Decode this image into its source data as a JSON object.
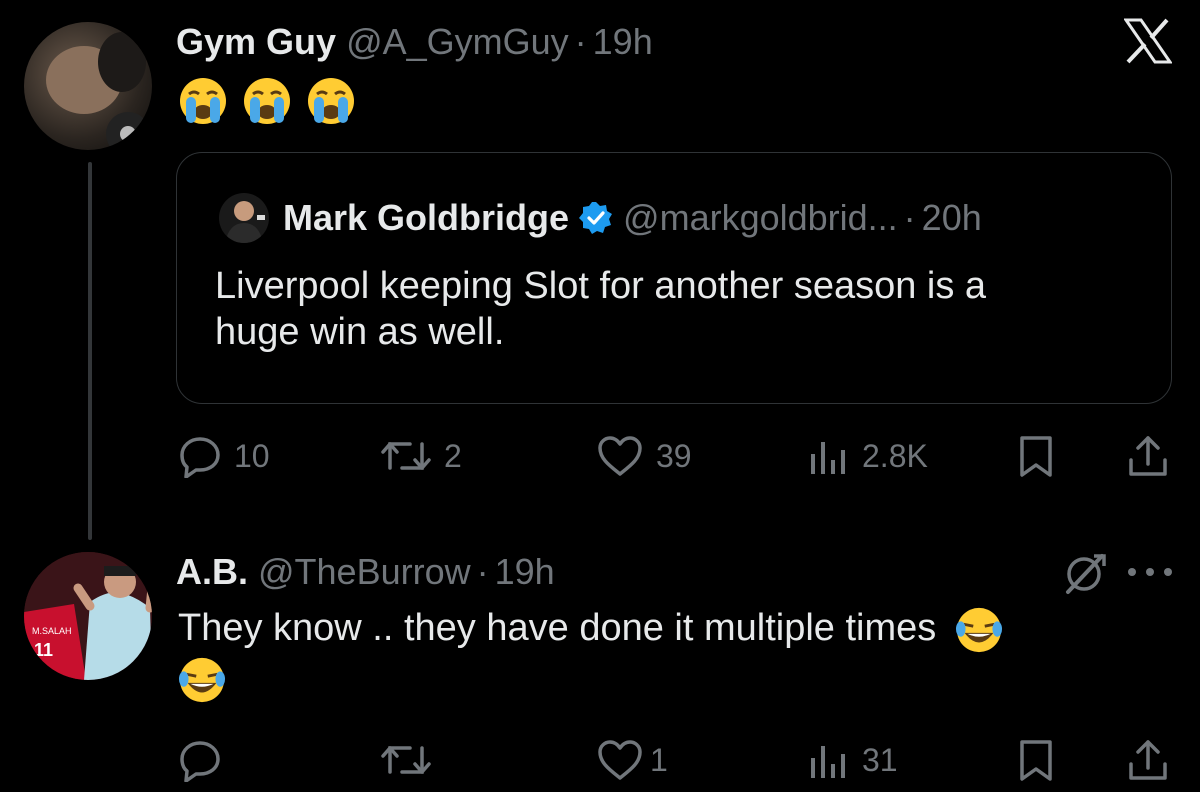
{
  "tweet": {
    "author_name": "Gym Guy",
    "handle": "@A_GymGuy",
    "separator": "·",
    "time": "19h",
    "emoji_count": 3
  },
  "quote": {
    "author_name": "Mark Goldbridge",
    "handle": "@markgoldbrid...",
    "separator": "·",
    "time": "20h",
    "text_line1": "Liverpool keeping Slot for another season is a",
    "text_line2": "huge win as well."
  },
  "tweet_metrics": {
    "replies": "10",
    "reposts": "2",
    "likes": "39",
    "views": "2.8K"
  },
  "reply": {
    "author_name": "A.B.",
    "handle": "@TheBurrow",
    "separator": "·",
    "time": "19h",
    "text": "They know .. they have done it multiple times",
    "avatar_jersey_name": "M.SALAH",
    "avatar_jersey_number": "11"
  },
  "reply_metrics": {
    "replies": "",
    "reposts": "",
    "likes": "1",
    "views": "31"
  },
  "colors": {
    "background": "#000000",
    "text": "#e7e9ea",
    "muted": "#71767b",
    "verified": "#1d9bf0",
    "border": "#2f3336"
  },
  "icons": [
    "x-logo-icon",
    "reply-icon",
    "repost-icon",
    "like-icon",
    "views-icon",
    "bookmark-icon",
    "share-icon",
    "verified-icon",
    "grok-icon",
    "more-icon",
    "crying-emoji",
    "laughing-emoji"
  ]
}
